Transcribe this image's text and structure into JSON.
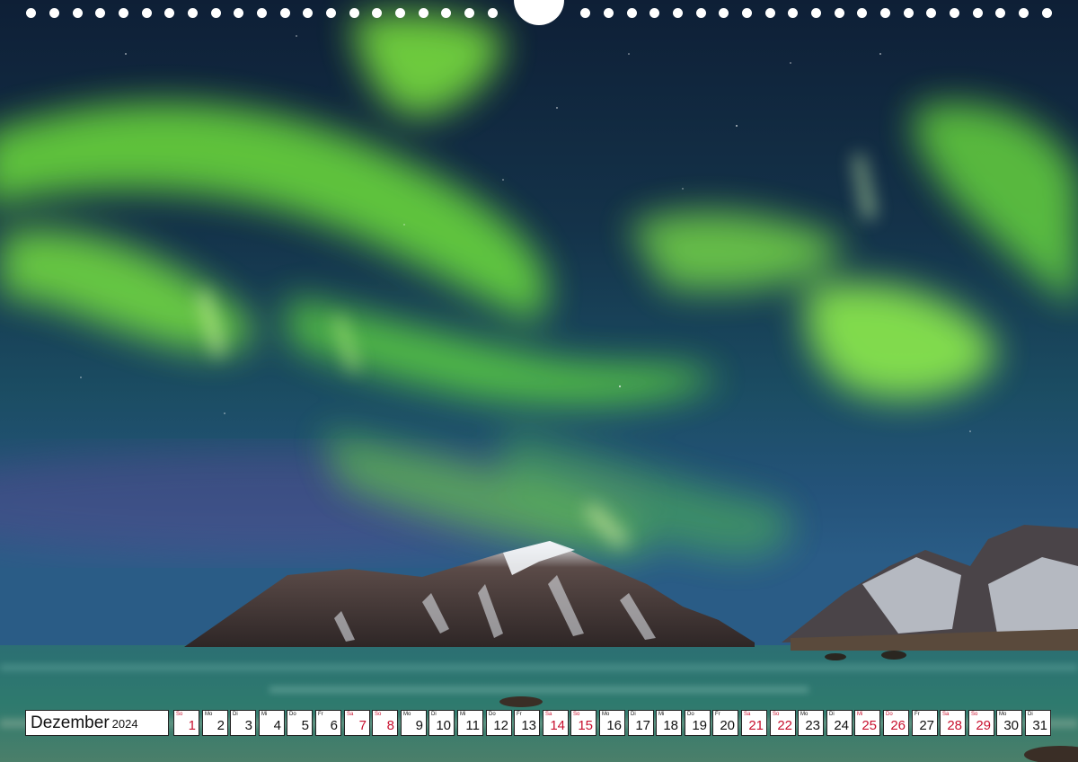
{
  "calendar": {
    "month": "Dezember",
    "year": "2024",
    "days": [
      {
        "wd": "So",
        "num": "1",
        "weekend": true
      },
      {
        "wd": "Mo",
        "num": "2",
        "weekend": false
      },
      {
        "wd": "Di",
        "num": "3",
        "weekend": false
      },
      {
        "wd": "Mi",
        "num": "4",
        "weekend": false
      },
      {
        "wd": "Do",
        "num": "5",
        "weekend": false
      },
      {
        "wd": "Fr",
        "num": "6",
        "weekend": false
      },
      {
        "wd": "Sa",
        "num": "7",
        "weekend": true
      },
      {
        "wd": "So",
        "num": "8",
        "weekend": true
      },
      {
        "wd": "Mo",
        "num": "9",
        "weekend": false
      },
      {
        "wd": "Di",
        "num": "10",
        "weekend": false
      },
      {
        "wd": "Mi",
        "num": "11",
        "weekend": false
      },
      {
        "wd": "Do",
        "num": "12",
        "weekend": false
      },
      {
        "wd": "Fr",
        "num": "13",
        "weekend": false
      },
      {
        "wd": "Sa",
        "num": "14",
        "weekend": true
      },
      {
        "wd": "So",
        "num": "15",
        "weekend": true
      },
      {
        "wd": "Mo",
        "num": "16",
        "weekend": false
      },
      {
        "wd": "Di",
        "num": "17",
        "weekend": false
      },
      {
        "wd": "Mi",
        "num": "18",
        "weekend": false
      },
      {
        "wd": "Do",
        "num": "19",
        "weekend": false
      },
      {
        "wd": "Fr",
        "num": "20",
        "weekend": false
      },
      {
        "wd": "Sa",
        "num": "21",
        "weekend": true
      },
      {
        "wd": "So",
        "num": "22",
        "weekend": true
      },
      {
        "wd": "Mo",
        "num": "23",
        "weekend": false
      },
      {
        "wd": "Di",
        "num": "24",
        "weekend": false
      },
      {
        "wd": "Mi",
        "num": "25",
        "weekend": true
      },
      {
        "wd": "Do",
        "num": "26",
        "weekend": true
      },
      {
        "wd": "Fr",
        "num": "27",
        "weekend": false
      },
      {
        "wd": "Sa",
        "num": "28",
        "weekend": true
      },
      {
        "wd": "So",
        "num": "29",
        "weekend": true
      },
      {
        "wd": "Mo",
        "num": "30",
        "weekend": false
      },
      {
        "wd": "Di",
        "num": "31",
        "weekend": false
      }
    ]
  },
  "colors": {
    "holiday_red": "#c8102e",
    "aurora_green": "#7dff3a",
    "sky_dark": "#0d1f3a"
  },
  "image": {
    "subject": "aurora-over-mountains-and-beach"
  }
}
